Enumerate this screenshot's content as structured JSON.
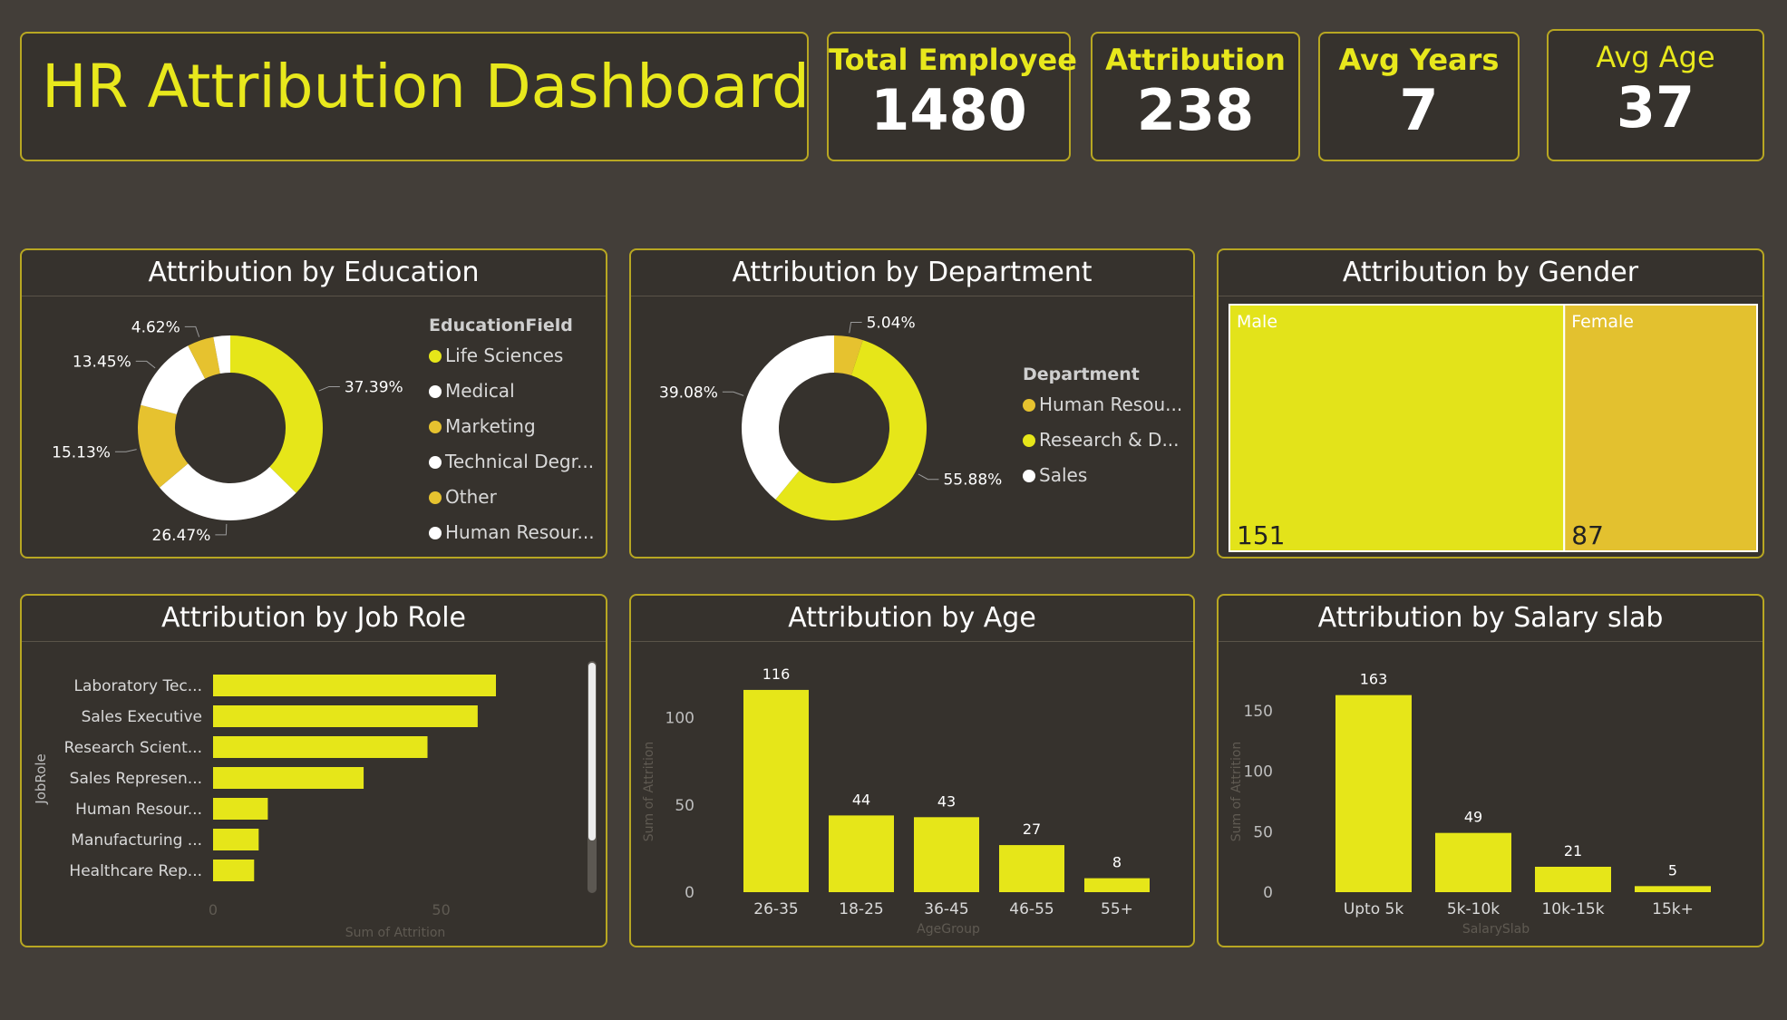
{
  "header": {
    "title": "HR Attribution Dashboard"
  },
  "kpis": [
    {
      "label": "Total Employee",
      "value": "1480"
    },
    {
      "label": "Attribution",
      "value": "238"
    },
    {
      "label": "Avg Years",
      "value": "7"
    },
    {
      "label": "Avg Age",
      "value": "37"
    }
  ],
  "colors": {
    "yellow": "#e6e619",
    "gold": "#e6c22f",
    "white": "#ffffff",
    "background": "#433e39",
    "panel": "#36322d",
    "border": "#b8a722"
  },
  "chart_data": [
    {
      "id": "education",
      "type": "pie",
      "title": "Attribution by Education",
      "legend_title": "EducationField",
      "legend": [
        "Life Sciences",
        "Medical",
        "Marketing",
        "Technical Degr...",
        "Other",
        "Human Resour..."
      ],
      "slices": [
        {
          "label": "Life Sciences",
          "value": 37.39,
          "display": "37.39%",
          "color": "#e6e619"
        },
        {
          "label": "Medical",
          "value": 26.47,
          "display": "26.47%",
          "color": "#ffffff"
        },
        {
          "label": "Marketing",
          "value": 15.13,
          "display": "15.13%",
          "color": "#e6c22f"
        },
        {
          "label": "Technical Degr...",
          "value": 13.45,
          "display": "13.45%",
          "color": "#ffffff"
        },
        {
          "label": "Other",
          "value": 4.62,
          "display": "4.62%",
          "color": "#e6c22f"
        },
        {
          "label": "Human Resour...",
          "value": 2.94,
          "display": "",
          "color": "#ffffff"
        }
      ]
    },
    {
      "id": "department",
      "type": "pie",
      "title": "Attribution by Department",
      "legend_title": "Department",
      "legend": [
        "Human Resou...",
        "Research & D...",
        "Sales"
      ],
      "slices": [
        {
          "label": "Human Resou...",
          "value": 5.04,
          "display": "5.04%",
          "color": "#e6c22f"
        },
        {
          "label": "Research & D...",
          "value": 55.88,
          "display": "55.88%",
          "color": "#e6e619"
        },
        {
          "label": "Sales",
          "value": 39.08,
          "display": "39.08%",
          "color": "#ffffff"
        }
      ]
    },
    {
      "id": "gender",
      "type": "treemap",
      "title": "Attribution by Gender",
      "items": [
        {
          "label": "Male",
          "value": 151,
          "color": "#e3e31a"
        },
        {
          "label": "Female",
          "value": 87,
          "color": "#e3c12f"
        }
      ]
    },
    {
      "id": "jobrole",
      "type": "bar",
      "orientation": "horizontal",
      "title": "Attribution by Job Role",
      "ylabel": "JobRole",
      "xlabel": "Sum of Attrition",
      "categories": [
        "Laboratory Tec...",
        "Sales Executive",
        "Research Scient...",
        "Sales Represen...",
        "Human Resour...",
        "Manufacturing ...",
        "Healthcare Rep..."
      ],
      "values": [
        62,
        58,
        47,
        33,
        12,
        10,
        9
      ],
      "xticks": [
        0,
        50
      ],
      "xlim": [
        0,
        62
      ]
    },
    {
      "id": "age",
      "type": "bar",
      "title": "Attribution by Age",
      "xlabel": "AgeGroup",
      "ylabel": "Sum of Attrition",
      "categories": [
        "26-35",
        "18-25",
        "36-45",
        "46-55",
        "55+"
      ],
      "values": [
        116,
        44,
        43,
        27,
        8
      ],
      "yticks": [
        0,
        50,
        100
      ],
      "ylim": [
        0,
        130
      ]
    },
    {
      "id": "salary",
      "type": "bar",
      "title": "Attribution by Salary slab",
      "xlabel": "SalarySlab",
      "ylabel": "Sum of Attrition",
      "categories": [
        "Upto 5k",
        "5k-10k",
        "10k-15k",
        "15k+"
      ],
      "values": [
        163,
        49,
        21,
        5
      ],
      "yticks": [
        0,
        50,
        100,
        150
      ],
      "ylim": [
        0,
        180
      ]
    }
  ]
}
